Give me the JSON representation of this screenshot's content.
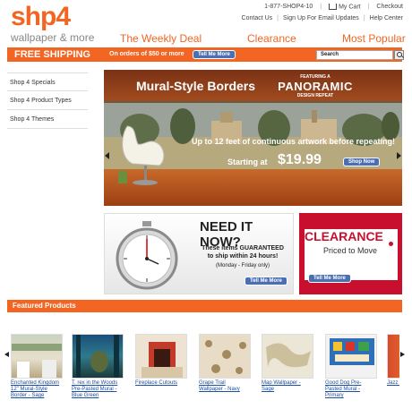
{
  "brand": {
    "logo_main": "sh",
    "logo_rest": "p4",
    "tagline": "wallpaper & more"
  },
  "utility": {
    "phone": "1-877-SHOP4-10",
    "cart": "My Cart",
    "checkout": "Checkout",
    "links": [
      "Contact Us",
      "Sign Up For Email Updates",
      "Help Center"
    ]
  },
  "nav": {
    "items": [
      "The Weekly Deal",
      "Clearance",
      "Most Popular"
    ]
  },
  "shipping": {
    "title": "FREE SHIPPING",
    "subtitle": "On orders of $50 or more",
    "button": "Tell Me More",
    "search_value": "Search"
  },
  "sidebar": {
    "items": [
      "Shop 4 Specials",
      "Shop 4 Product Types",
      "Shop 4 Themes"
    ]
  },
  "hero": {
    "title": "Mural-Style Borders",
    "badge_top": "FEATURING A",
    "badge_word": "PANORAMIC",
    "badge_bottom": "DESIGN REPEAT",
    "subtitle": "Up to 12 feet of continuous artwork before repeating!",
    "starting_label": "Starting at",
    "price": "$19.99",
    "button": "Shop Now"
  },
  "need_it": {
    "title": "NEED IT NOW?",
    "line1": "These items GUARANTEED",
    "line2": "to ship within 24 hours!",
    "line3": "(Monday - Friday only)",
    "button": "Tell Me More"
  },
  "clearance": {
    "title": "CLEARANCE",
    "subtitle": "Priced to Move",
    "button": "Tell Me More"
  },
  "featured": {
    "title": "Featured Products",
    "products": [
      {
        "name": "Enchanted Kingdom 12\" Mural-Style Border - Sage"
      },
      {
        "name": "T. rex in the Woods Pre-Pasted Mural - Blue Green"
      },
      {
        "name": "Fireplace Cutouts"
      },
      {
        "name": "Grape Trail Wallpaper - Navy"
      },
      {
        "name": "Map Wallpaper - Sage"
      },
      {
        "name": "Good Dog Pre-Pasted Mural - Primary"
      },
      {
        "name": "Jazz I"
      }
    ]
  },
  "colors": {
    "brand_orange": "#f26522",
    "button_blue": "#4a6fb5",
    "clearance_red": "#c8102e",
    "link_blue": "#1f4fa0"
  }
}
